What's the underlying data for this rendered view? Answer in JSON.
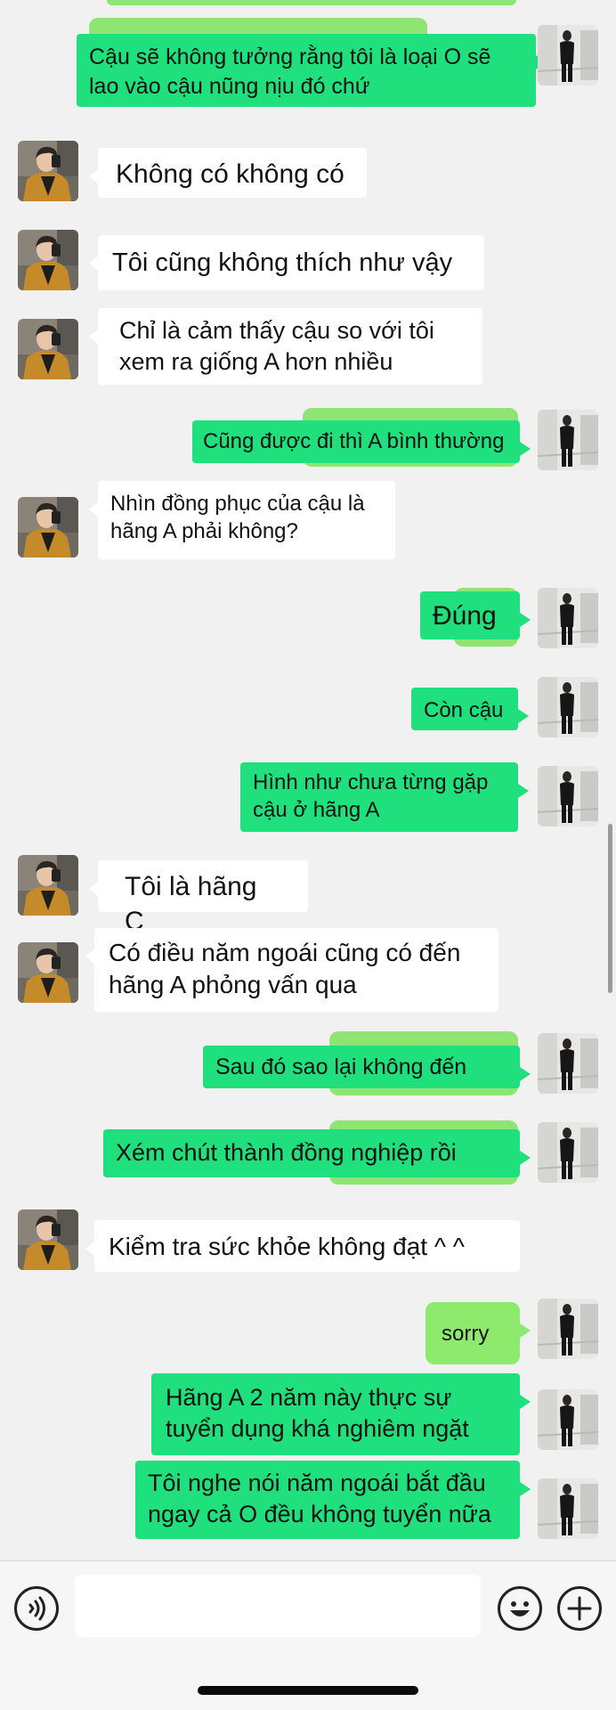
{
  "chat": {
    "messages": [
      {
        "side": "out",
        "text": "Cậu sẽ không tưởng rằng tôi là loại O sẽ\nlao vào cậu nũng nịu đó chứ"
      },
      {
        "side": "in",
        "text": "Không có không có"
      },
      {
        "side": "in",
        "text": "Tôi cũng không thích như vậy"
      },
      {
        "side": "in",
        "text": "Chỉ là cảm thấy cậu so với tôi\nxem ra giống A hơn nhiều"
      },
      {
        "side": "out",
        "text": "Cũng được đi thì A bình thường"
      },
      {
        "side": "in",
        "text": "Nhìn đồng phục của cậu là\nhãng A phải không?"
      },
      {
        "side": "out",
        "text": "Đúng"
      },
      {
        "side": "out",
        "text": "Còn cậu"
      },
      {
        "side": "out",
        "text": "Hình như chưa từng gặp\ncậu ở hãng A"
      },
      {
        "side": "in",
        "text": "Tôi là hãng C"
      },
      {
        "side": "in",
        "text": "Có điều năm ngoái cũng có đến\nhãng A phỏng vấn qua"
      },
      {
        "side": "out",
        "text": "Sau đó sao lại không đến"
      },
      {
        "side": "out",
        "text": "Xém chút thành đồng nghiệp rồi"
      },
      {
        "side": "in",
        "text": "Kiểm tra sức khỏe không đạt ^ ^"
      },
      {
        "side": "out",
        "text": "sorry"
      },
      {
        "side": "out",
        "text": "Hãng A 2 năm này thực sự\ntuyển dụng khá nghiêm ngặt"
      },
      {
        "side": "out",
        "text": "Tôi nghe nói năm ngoái bắt đầu\nngay cả O đều không tuyển nữa"
      }
    ]
  },
  "input_bar": {
    "voice_icon": "voice-icon",
    "message_placeholder": "",
    "emoji_icon": "emoji-icon",
    "add_icon": "plus-icon"
  },
  "colors": {
    "outgoing_bubble": "#1fe07c",
    "incoming_bubble": "#ffffff",
    "background": "#f1f1f1"
  }
}
